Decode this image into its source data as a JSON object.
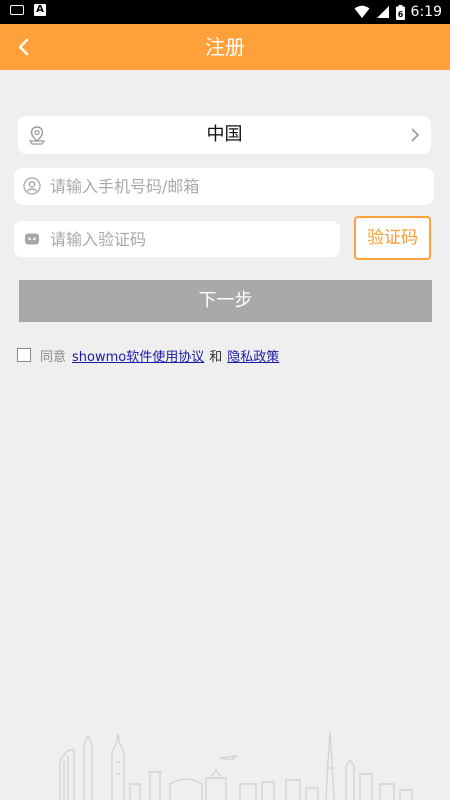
{
  "status_bar": {
    "time": "6:19",
    "battery_level": "6",
    "icons": [
      "keyboard-icon",
      "a-app-icon",
      "wifi-icon",
      "signal-icon",
      "battery-icon"
    ]
  },
  "header": {
    "title": "注册",
    "back_icon": "back-chevron-icon",
    "background_color": "#ffa03a"
  },
  "form": {
    "country": {
      "value": "中国",
      "icon": "location-pin-icon",
      "chevron": "chevron-right-icon"
    },
    "phone": {
      "placeholder": "请输入手机号码/邮箱",
      "value": "",
      "icon": "user-icon"
    },
    "code": {
      "placeholder": "请输入验证码",
      "value": "",
      "icon": "robot-icon"
    },
    "code_button_label": "验证码",
    "next_button_label": "下一步"
  },
  "agreement": {
    "checked": false,
    "prefix": "同意",
    "terms_link": "showmo软件使用协议",
    "and": "和",
    "privacy_link": "隐私政策"
  },
  "colors": {
    "accent": "#ffa03a",
    "disabled_button": "#a9a9a9",
    "link": "#1a1aa6",
    "background": "#efefef"
  }
}
